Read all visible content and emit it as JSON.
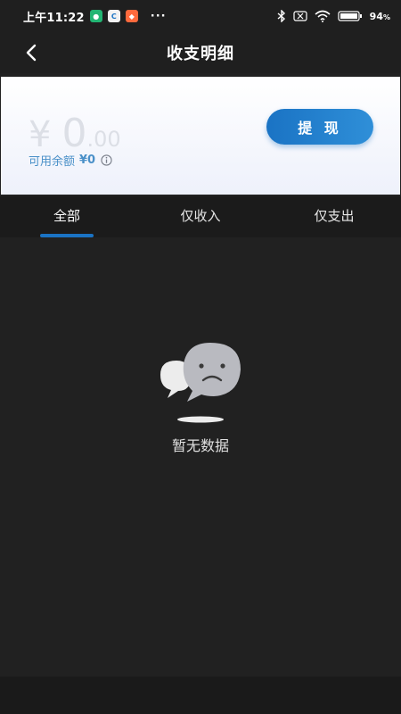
{
  "status_bar": {
    "time": "上午11:22",
    "overflow": "···",
    "battery": "94"
  },
  "nav": {
    "title": "收支明细",
    "back_icon": "chevron-left-icon"
  },
  "balance": {
    "currency": "¥",
    "integer": "0",
    "decimal": ".00",
    "available_label": "可用余额",
    "available_value": "¥0",
    "withdraw_label": "提 现"
  },
  "tabs": [
    {
      "label": "全部",
      "active": true
    },
    {
      "label": "仅收入",
      "active": false
    },
    {
      "label": "仅支出",
      "active": false
    }
  ],
  "empty_state": {
    "text": "暂无数据",
    "icon": "sad-chat-bubble-icon"
  },
  "colors": {
    "accent": "#1a73c4",
    "background": "#212121",
    "card": "#ffffff"
  }
}
